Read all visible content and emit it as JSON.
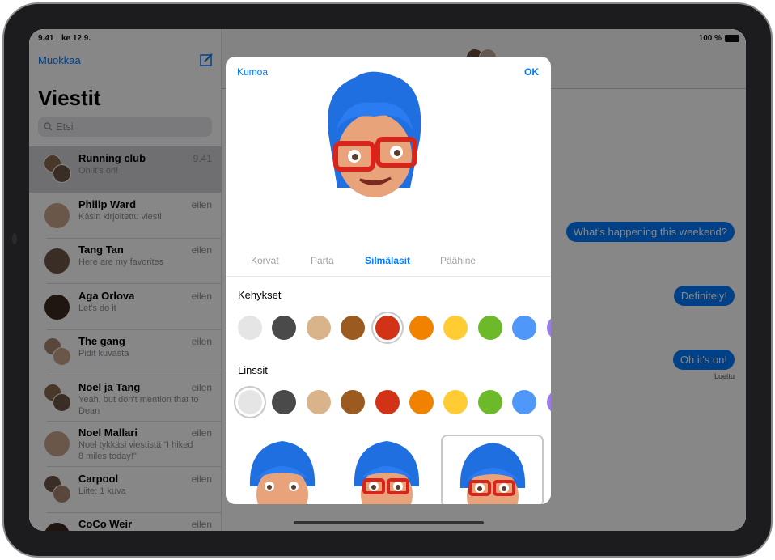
{
  "status_bar": {
    "time": "9.41",
    "date": "ke 12.9.",
    "battery": "100 %"
  },
  "sidebar": {
    "edit_label": "Muokkaa",
    "compose_icon": "compose-icon",
    "title": "Viestit",
    "search_placeholder": "Etsi",
    "conversations": [
      {
        "name": "Running club",
        "preview": "Oh it's on!",
        "time": "9.41",
        "group": true,
        "selected": true
      },
      {
        "name": "Philip Ward",
        "preview": "Käsin kirjoitettu viesti",
        "time": "eilen",
        "group": false
      },
      {
        "name": "Tang Tan",
        "preview": "Here are my favorites",
        "time": "eilen",
        "group": false
      },
      {
        "name": "Aga Orlova",
        "preview": "Let's do it",
        "time": "eilen",
        "group": false
      },
      {
        "name": "The gang",
        "preview": "Pidit kuvasta",
        "time": "eilen",
        "group": true
      },
      {
        "name": "Noel ja Tang",
        "preview": "Yeah, but don't mention that to Dean",
        "time": "eilen",
        "group": true
      },
      {
        "name": "Noel Mallari",
        "preview": "Noel tykkäsi viestistä \"I hiked 8 miles today!\"",
        "time": "eilen",
        "group": false
      },
      {
        "name": "Carpool",
        "preview": "Liite: 1 kuva",
        "time": "eilen",
        "group": true
      },
      {
        "name": "CoCo Weir",
        "preview": "",
        "time": "eilen",
        "group": false
      }
    ]
  },
  "chat": {
    "messages": [
      "What's happening this weekend?",
      "Definitely!",
      "Oh it's on!"
    ],
    "read_receipt": "Luettu",
    "bubble_color": "#007aff"
  },
  "modal": {
    "cancel_label": "Kumoa",
    "ok_label": "OK",
    "tabs": [
      {
        "label": "Korvat"
      },
      {
        "label": "Parta"
      },
      {
        "label": "Silmälasit",
        "active": true
      },
      {
        "label": "Päähine"
      }
    ],
    "frames": {
      "label": "Kehykset",
      "selected": 4
    },
    "lenses": {
      "label": "Linssit",
      "selected": 0
    },
    "colors": [
      "#e5e5e5",
      "#4a4a4a",
      "#d9b48a",
      "#9a5a20",
      "#d23215",
      "#f08200",
      "#ffcc33",
      "#6cb92a",
      "#4f97f9",
      "#9b7ce6"
    ],
    "selected_style": 2
  }
}
